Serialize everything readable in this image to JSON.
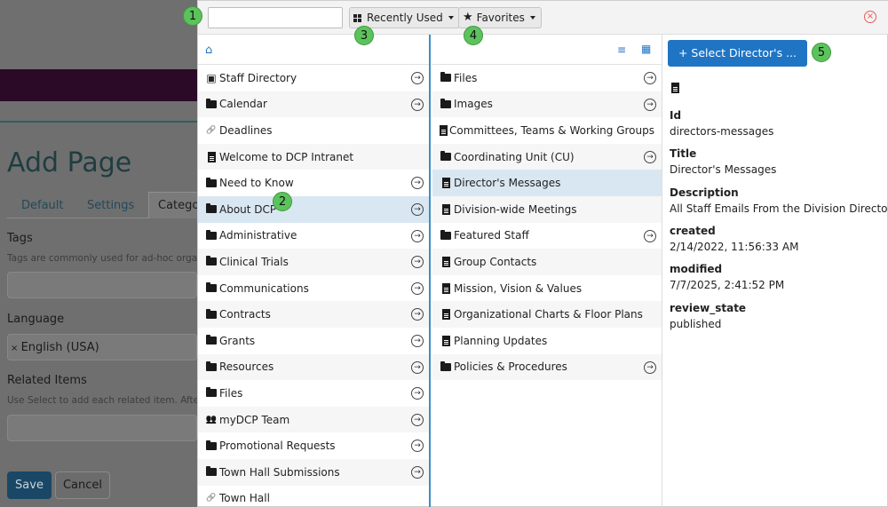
{
  "background": {
    "page_title": "Add Page",
    "tabs": [
      "Default",
      "Settings",
      "Categor"
    ],
    "tags_label": "Tags",
    "tags_help": "Tags are commonly used for ad-hoc organ",
    "language_label": "Language",
    "language_value": "English (USA)",
    "related_label": "Related Items",
    "related_help": "Use Select to add each related item. After a",
    "save_label": "Save",
    "cancel_label": "Cancel"
  },
  "toolbar": {
    "search_value": "",
    "recent_label": "Recently Used",
    "favorites_label": "Favorites",
    "close_glyph": "×"
  },
  "col1": [
    {
      "label": "Staff Directory",
      "icon": "contact-card-icon",
      "arrow": true
    },
    {
      "label": "Calendar",
      "icon": "folder-icon",
      "arrow": true
    },
    {
      "label": "Deadlines",
      "icon": "link-icon",
      "arrow": false
    },
    {
      "label": "Welcome to DCP Intranet",
      "icon": "document-icon",
      "arrow": false
    },
    {
      "label": "Need to Know",
      "icon": "folder-icon",
      "arrow": true
    },
    {
      "label": "About DCP",
      "icon": "folder-icon",
      "arrow": true,
      "selected": true
    },
    {
      "label": "Administrative",
      "icon": "folder-icon",
      "arrow": true
    },
    {
      "label": "Clinical Trials",
      "icon": "folder-icon",
      "arrow": true
    },
    {
      "label": "Communications",
      "icon": "folder-icon",
      "arrow": true
    },
    {
      "label": "Contracts",
      "icon": "folder-icon",
      "arrow": true
    },
    {
      "label": "Grants",
      "icon": "folder-icon",
      "arrow": true
    },
    {
      "label": "Resources",
      "icon": "folder-icon",
      "arrow": true
    },
    {
      "label": "Files",
      "icon": "folder-icon",
      "arrow": true
    },
    {
      "label": "myDCP Team",
      "icon": "people-icon",
      "arrow": true
    },
    {
      "label": "Promotional Requests",
      "icon": "folder-icon",
      "arrow": true
    },
    {
      "label": "Town Hall Submissions",
      "icon": "folder-icon",
      "arrow": true
    },
    {
      "label": "Town Hall",
      "icon": "link-icon",
      "arrow": false
    }
  ],
  "col2": [
    {
      "label": "Files",
      "icon": "folder-icon",
      "arrow": true
    },
    {
      "label": "Images",
      "icon": "folder-icon",
      "arrow": true
    },
    {
      "label": "Committees, Teams & Working Groups",
      "icon": "document-icon",
      "arrow": false
    },
    {
      "label": "Coordinating Unit (CU)",
      "icon": "folder-icon",
      "arrow": true
    },
    {
      "label": "Director's Messages",
      "icon": "document-icon",
      "arrow": false,
      "selected": true
    },
    {
      "label": "Division-wide Meetings",
      "icon": "document-icon",
      "arrow": false
    },
    {
      "label": "Featured Staff",
      "icon": "folder-icon",
      "arrow": true
    },
    {
      "label": "Group Contacts",
      "icon": "document-icon",
      "arrow": false
    },
    {
      "label": "Mission, Vision & Values",
      "icon": "document-icon",
      "arrow": false
    },
    {
      "label": "Organizational Charts & Floor Plans",
      "icon": "document-icon",
      "arrow": false
    },
    {
      "label": "Planning Updates",
      "icon": "document-icon",
      "arrow": false
    },
    {
      "label": "Policies & Procedures",
      "icon": "folder-icon",
      "arrow": true
    }
  ],
  "details": {
    "select_button": "+ Select Director's ...",
    "id_label": "Id",
    "id_value": "directors-messages",
    "title_label": "Title",
    "title_value": "Director's Messages",
    "description_label": "Description",
    "description_value": "All Staff Emails From the Division Director",
    "created_label": "created",
    "created_value": "2/14/2022, 11:56:33 AM",
    "modified_label": "modified",
    "modified_value": "7/7/2025, 2:41:52 PM",
    "review_label": "review_state",
    "review_value": "published"
  },
  "badges": [
    "1",
    "2",
    "3",
    "4",
    "5"
  ]
}
